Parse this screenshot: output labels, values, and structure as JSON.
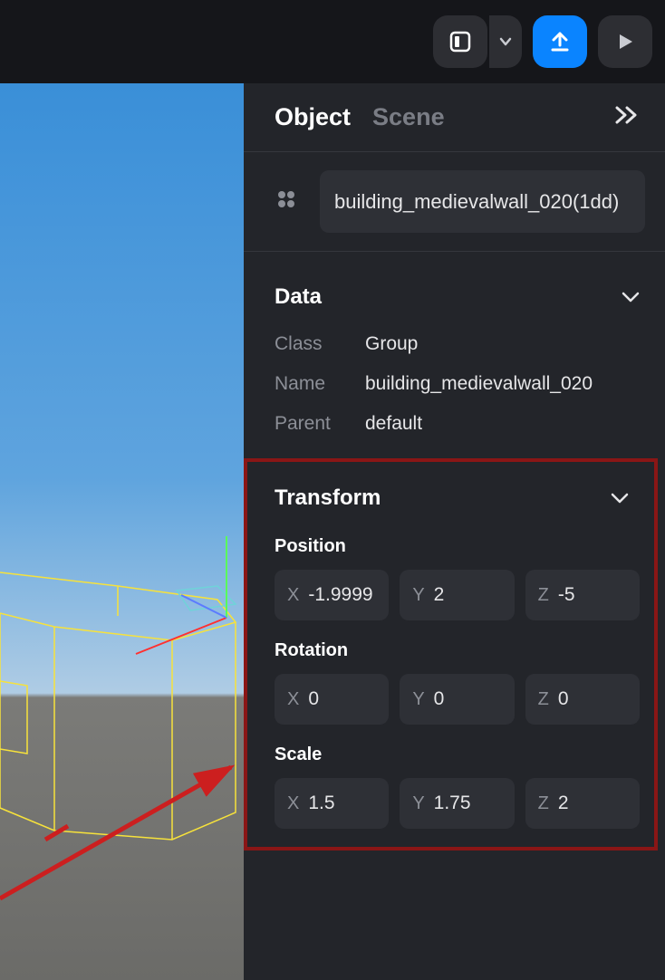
{
  "tabs": {
    "object": "Object",
    "scene": "Scene"
  },
  "name_display": "building_medievalwall_020(1dd)",
  "sections": {
    "data": "Data",
    "transform": "Transform",
    "position": "Position",
    "rotation": "Rotation",
    "scale": "Scale"
  },
  "data": {
    "labels": {
      "class": "Class",
      "name": "Name",
      "parent": "Parent"
    },
    "class": "Group",
    "name": "building_medievalwall_020",
    "parent": "default"
  },
  "transform": {
    "axes": {
      "x": "X",
      "y": "Y",
      "z": "Z"
    },
    "position": {
      "x": "-1.9999",
      "y": "2",
      "z": "-5"
    },
    "rotation": {
      "x": "0",
      "y": "0",
      "z": "0"
    },
    "scale": {
      "x": "1.5",
      "y": "1.75",
      "z": "2"
    }
  }
}
